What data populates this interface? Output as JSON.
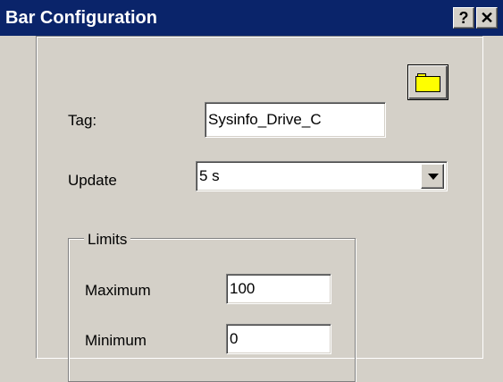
{
  "window": {
    "title": "Bar Configuration",
    "help_button": "?",
    "close_button": "✕"
  },
  "form": {
    "tag": {
      "label": "Tag:",
      "value": "Sysinfo_Drive_C"
    },
    "update": {
      "label": "Update",
      "selected": "5 s"
    },
    "limits": {
      "legend": "Limits",
      "maximum": {
        "label": "Maximum",
        "value": "100"
      },
      "minimum": {
        "label": "Minimum",
        "value": "0"
      }
    }
  },
  "icons": {
    "browse": "folder-icon",
    "dropdown": "chevron-down-icon"
  },
  "colors": {
    "titlebar": "#0a246a",
    "face": "#d4d0c8",
    "folder": "#ffff00"
  }
}
